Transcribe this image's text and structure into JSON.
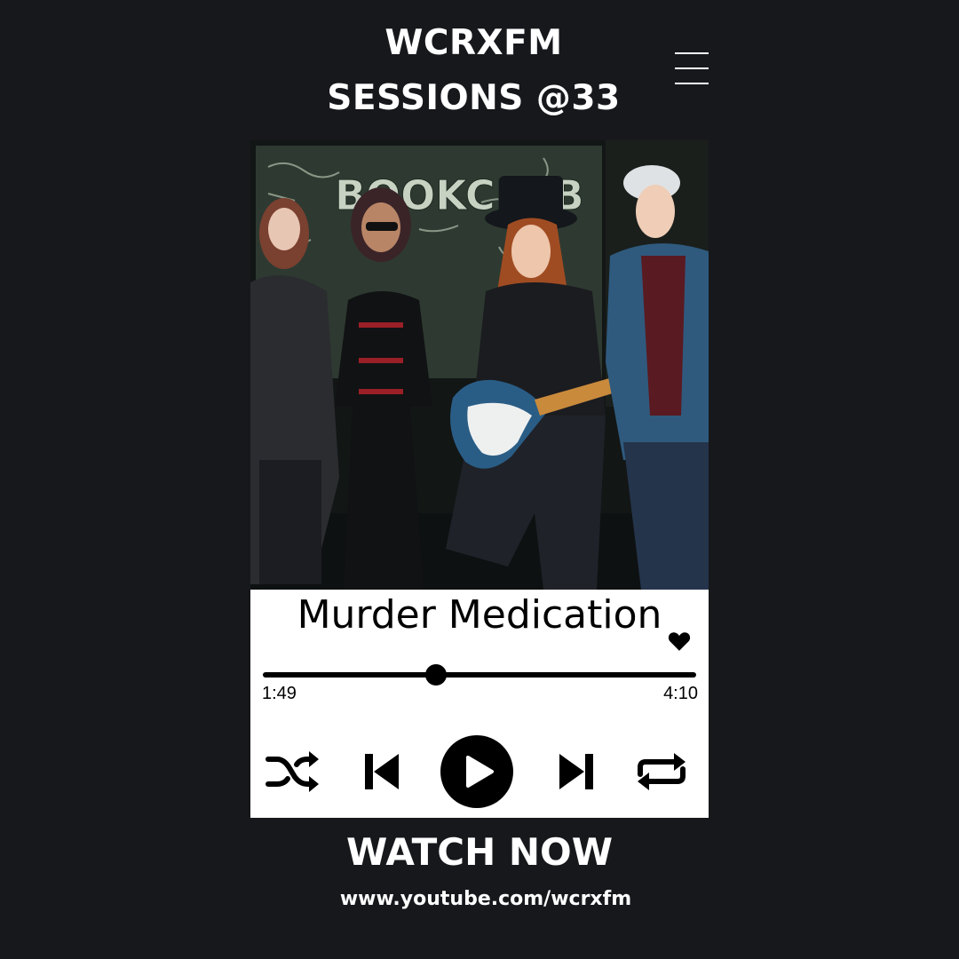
{
  "header": {
    "line1": "WCRXFM",
    "line2": "SESSIONS @33",
    "menu_icon": "hamburger-menu-icon"
  },
  "album_art": {
    "wall_text": "BOOKCLUB"
  },
  "player": {
    "track_title": "Murder Medication",
    "elapsed": "1:49",
    "duration": "4:10",
    "progress_fraction": 0.4,
    "icons": {
      "favorite": "heart-icon",
      "shuffle": "shuffle-icon",
      "previous": "skip-previous-icon",
      "play": "play-icon",
      "next": "skip-next-icon",
      "repeat": "repeat-icon"
    }
  },
  "cta": {
    "label": "WATCH NOW",
    "url": "www.youtube.com/wcrxfm"
  },
  "colors": {
    "background": "#17181c",
    "card": "#ffffff",
    "text_light": "#ffffff",
    "text_dark": "#000000"
  }
}
